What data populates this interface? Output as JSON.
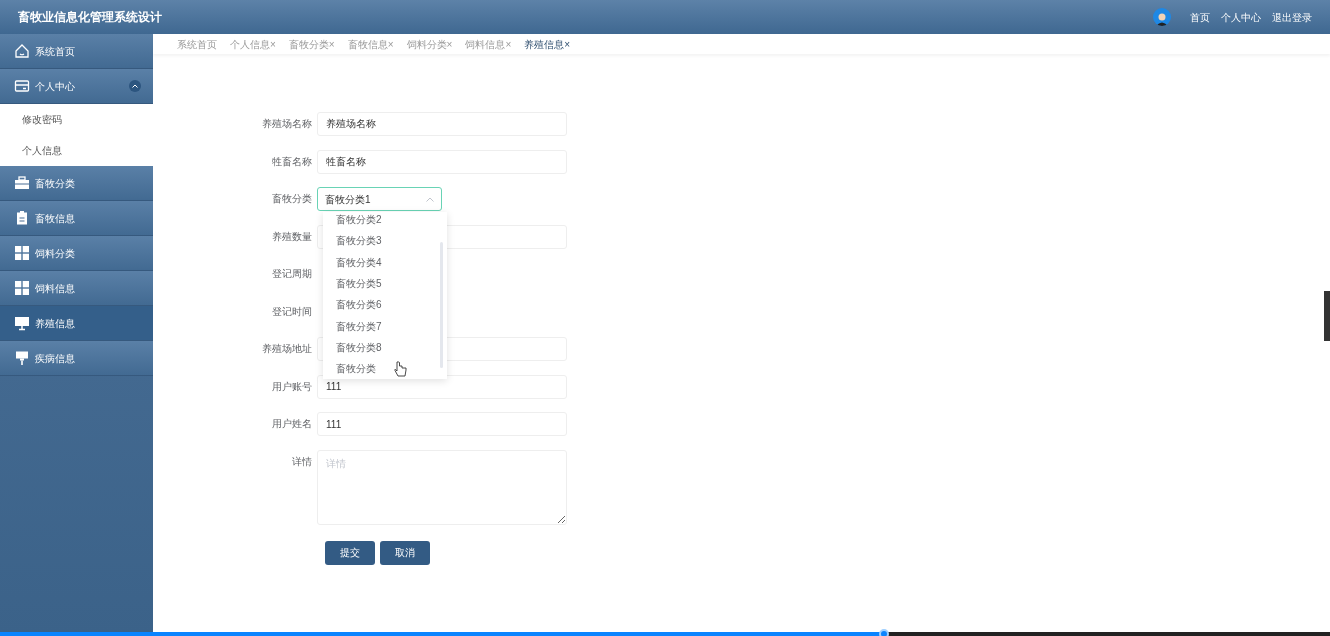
{
  "header": {
    "title": "畜牧业信息化管理系统设计",
    "links": [
      "首页",
      "个人中心",
      "退出登录"
    ]
  },
  "sidebar": {
    "items": [
      {
        "label": "系统首页",
        "kind": "home",
        "selected": false
      },
      {
        "label": "个人中心",
        "kind": "card",
        "selected": false,
        "expanded": true,
        "children": [
          {
            "label": "修改密码"
          },
          {
            "label": "个人信息"
          }
        ]
      },
      {
        "label": "畜牧分类",
        "kind": "briefcase",
        "selected": false
      },
      {
        "label": "畜牧信息",
        "kind": "clipboard",
        "selected": false
      },
      {
        "label": "饲料分类",
        "kind": "grid",
        "selected": false
      },
      {
        "label": "饲料信息",
        "kind": "grid",
        "selected": false
      },
      {
        "label": "养殖信息",
        "kind": "monitor",
        "selected": true
      },
      {
        "label": "疾病信息",
        "kind": "sign",
        "selected": false
      }
    ]
  },
  "tabs": [
    {
      "label": "系统首页",
      "selected": false
    },
    {
      "label": "个人信息×",
      "selected": false
    },
    {
      "label": "畜牧分类×",
      "selected": false
    },
    {
      "label": "畜牧信息×",
      "selected": false
    },
    {
      "label": "饲料分类×",
      "selected": false
    },
    {
      "label": "饲料信息×",
      "selected": false
    },
    {
      "label": "养殖信息×",
      "selected": true
    }
  ],
  "form": {
    "fields": [
      {
        "label": "养殖场名称",
        "kind": "text",
        "value": "养殖场名称"
      },
      {
        "label": "牲畜名称",
        "kind": "text",
        "value": "牲畜名称"
      },
      {
        "label": "畜牧分类",
        "kind": "select",
        "value": "畜牧分类1",
        "expanded": true
      },
      {
        "label": "养殖数量",
        "kind": "text"
      },
      {
        "label": "登记周期",
        "kind": "hidden"
      },
      {
        "label": "登记时间",
        "kind": "hidden"
      },
      {
        "label": "养殖场地址",
        "kind": "text"
      },
      {
        "label": "用户账号",
        "kind": "text",
        "value": "111"
      },
      {
        "label": "用户姓名",
        "kind": "text",
        "value": "111"
      },
      {
        "label": "详情",
        "kind": "textarea",
        "placeholder": "详情"
      }
    ],
    "dropdown_options": [
      "畜牧分类2",
      "畜牧分类3",
      "畜牧分类4",
      "畜牧分类5",
      "畜牧分类6",
      "畜牧分类7",
      "畜牧分类8",
      "畜牧分类"
    ],
    "buttons": [
      "提交",
      "取消"
    ]
  },
  "video_progress": {
    "level": 0.665
  }
}
